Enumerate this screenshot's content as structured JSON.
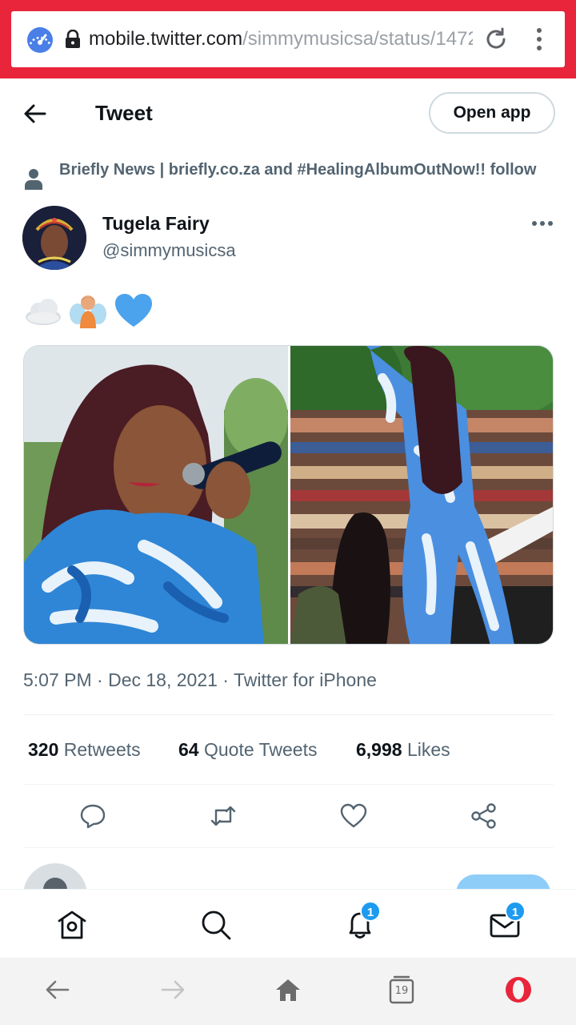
{
  "browser": {
    "url_domain": "mobile.twitter.com",
    "url_path": "/simmymusicsa/status/1472",
    "tabs_count": "19",
    "opera_color": "#e8253a"
  },
  "header": {
    "title": "Tweet",
    "open_app_label": "Open app"
  },
  "tweet": {
    "social_context": "Briefly News | briefly.co.za and #HealingAlbumOutNow!! follow",
    "author_name": "Tugela Fairy",
    "author_handle": "@simmymusicsa",
    "emojis": [
      "cloud",
      "fairy",
      "blue-heart"
    ],
    "timestamp": "5:07 PM · Dec 18, 2021 · Twitter for iPhone",
    "stats": {
      "retweets_count": "320",
      "retweets_label": "Retweets",
      "quotes_count": "64",
      "quotes_label": "Quote Tweets",
      "likes_count": "6,998",
      "likes_label": "Likes"
    },
    "actions": [
      "reply-icon",
      "retweet-icon",
      "like-icon",
      "share-icon"
    ]
  },
  "bottom_nav": {
    "items": [
      "home-icon",
      "search-icon",
      "notifications-icon",
      "messages-icon"
    ],
    "notifications_badge": "1",
    "messages_badge": "1",
    "badge_color": "#1d9bf0"
  }
}
